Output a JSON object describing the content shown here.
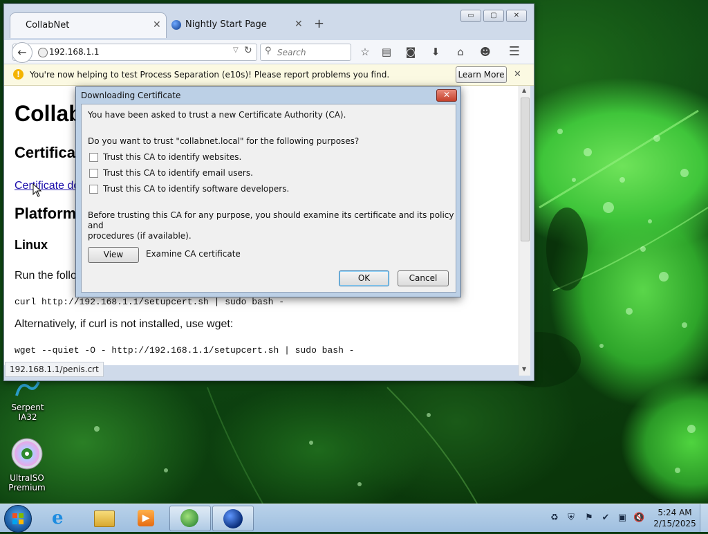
{
  "desktop": {
    "icons": [
      {
        "label": "Serpent IA32"
      },
      {
        "label": "UltraISO Premium"
      }
    ]
  },
  "browser": {
    "tabs": [
      {
        "label": "CollabNet",
        "active": true
      },
      {
        "label": "Nightly Start Page",
        "active": false
      }
    ],
    "window_controls": {
      "minimize": "▭",
      "maximize": "▢",
      "close": "✕"
    },
    "url": "192.168.1.1",
    "search_placeholder": "Search",
    "notification": {
      "text": "You're now helping to test Process Separation (e10s)! Please report problems you find.",
      "button": "Learn More"
    },
    "page": {
      "h1": "Collab",
      "h2_cert": "Certifica",
      "link_cert": "Certificate do",
      "h2_platform": "Platform",
      "h3_linux": "Linux",
      "run_text": "Run the follow",
      "curl_cmd": "curl http://192.168.1.1/setupcert.sh | sudo bash -",
      "alt_text": "Alternatively, if curl is not installed, use wget:",
      "wget_cmd": "wget --quiet -O - http://192.168.1.1/setupcert.sh | sudo bash -"
    },
    "status_url": "192.168.1.1/penis.crt"
  },
  "dialog": {
    "title": "Downloading Certificate",
    "intro": "You have been asked to trust a new Certificate Authority (CA).",
    "question": "Do you want to trust \"collabnet.local\" for the following purposes?",
    "checkboxes": [
      {
        "label": "Trust this CA to identify websites.",
        "checked": false
      },
      {
        "label": "Trust this CA to identify email users.",
        "checked": false
      },
      {
        "label": "Trust this CA to identify software developers.",
        "checked": false
      }
    ],
    "advice_line1": "Before trusting this CA for any purpose, you should examine its certificate and its policy and",
    "advice_line2": "procedures (if available).",
    "view_button": "View",
    "view_caption": "Examine CA certificate",
    "ok_button": "OK",
    "cancel_button": "Cancel"
  },
  "taskbar": {
    "clock_time": "5:24 AM",
    "clock_date": "2/15/2025"
  }
}
